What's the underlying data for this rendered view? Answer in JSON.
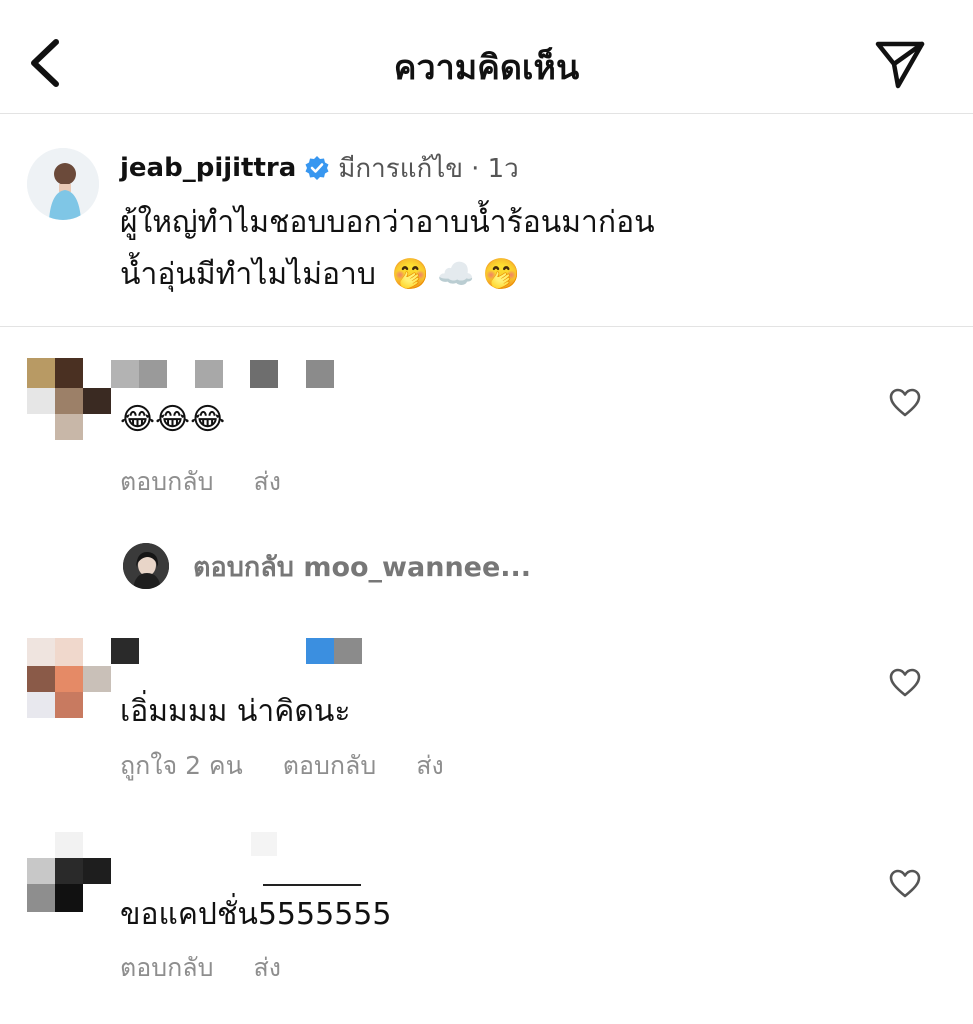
{
  "header": {
    "title": "ความคิดเห็น"
  },
  "caption": {
    "username": "jeab_pijittra",
    "edited": "มีการแก้ไข",
    "time": "· 1ว",
    "line1": "ผู้ใหญ่ทำไมชอบบอกว่าอาบน้ำร้อนมาก่อน",
    "line2": "น้ำอุ่นมีทำไมไม่อาบ",
    "emojis": [
      "🤭",
      "☁️",
      "🤭"
    ]
  },
  "comments": [
    {
      "text": "😂😂😂",
      "actions": {
        "reply": "ตอบกลับ",
        "send": "ส่ง"
      }
    },
    {
      "text": "เอิ่มมมม น่าคิดนะ",
      "actions": {
        "likes": "ถูกใจ 2 คน",
        "reply": "ตอบกลับ",
        "send": "ส่ง"
      }
    },
    {
      "text": "ขอแคปชั่น5555555",
      "actions": {
        "reply": "ตอบกลับ",
        "send": "ส่ง"
      }
    }
  ],
  "view_replies": {
    "label": "ตอบกลับ moo_wannee..."
  },
  "icons": {
    "back": "chevron-left-icon",
    "send": "paper-plane-icon",
    "verified": "verified-badge-icon",
    "like": "heart-outline-icon"
  },
  "colors": {
    "verified": "#3897f0",
    "secondary_text": "#8e8e8e",
    "divider": "#e3e3e3"
  }
}
